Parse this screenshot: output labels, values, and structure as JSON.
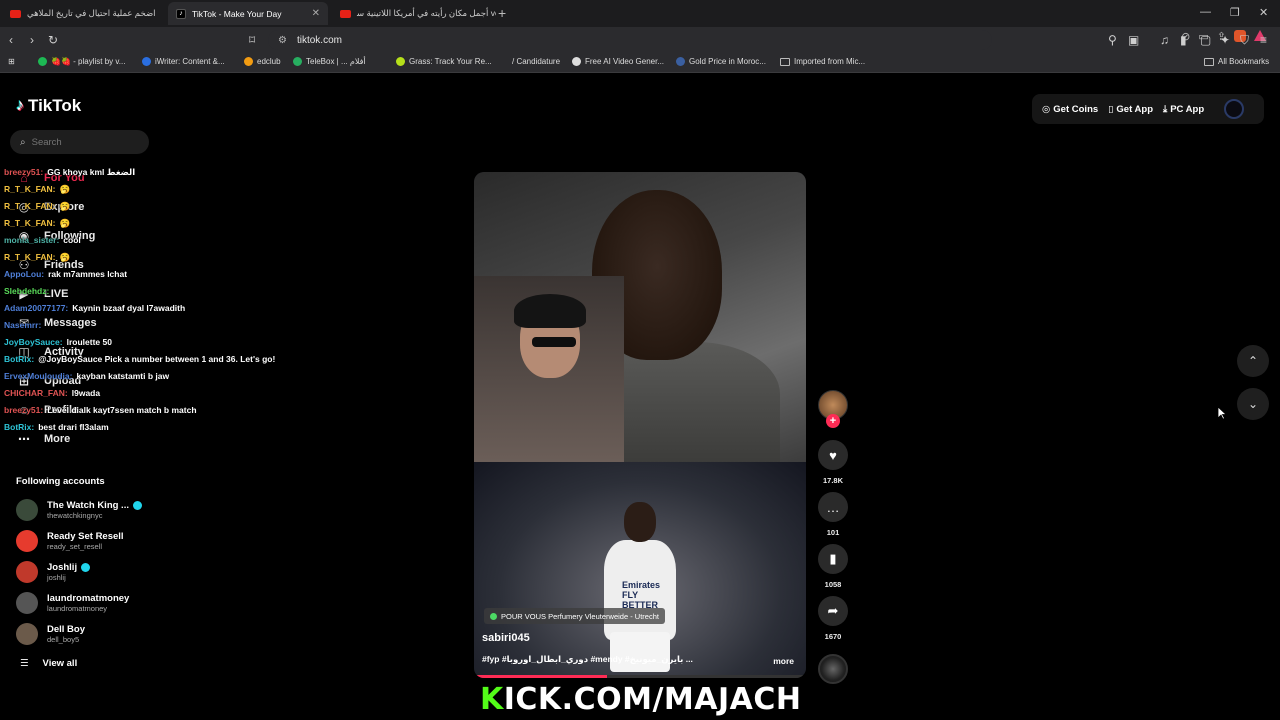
{
  "browser": {
    "tabs": [
      {
        "title": "اضخم عملية احتيال في تاريخ الملاهي",
        "active": false
      },
      {
        "title": "TikTok - Make Your Day",
        "active": true
      },
      {
        "title": "أجمل مكان رأيته في أمريكا اللاتينية ﺳ ve",
        "active": false
      }
    ],
    "url": "tiktok.com",
    "bookmarks": [
      {
        "label": "🍓🍓 - playlist by v..."
      },
      {
        "label": "iWriter: Content &..."
      },
      {
        "label": "edclub"
      },
      {
        "label": "TeleBox | ... أفلام"
      },
      {
        "label": "Grass: Track Your Re..."
      },
      {
        "label": "/ Candidature"
      },
      {
        "label": "Free AI Video Gener..."
      },
      {
        "label": "Gold Price in Moroc..."
      },
      {
        "label": "Imported from Mic..."
      }
    ],
    "all_bookmarks": "All Bookmarks"
  },
  "tiktok": {
    "logo": "TikTok",
    "search_placeholder": "Search",
    "nav": [
      {
        "label": "For You",
        "icon": "home-icon"
      },
      {
        "label": "Explore",
        "icon": "compass-icon"
      },
      {
        "label": "Following",
        "icon": "following-icon"
      },
      {
        "label": "Friends",
        "icon": "friends-icon"
      },
      {
        "label": "LIVE",
        "icon": "live-icon"
      },
      {
        "label": "Messages",
        "icon": "messages-icon"
      },
      {
        "label": "Activity",
        "icon": "activity-icon"
      },
      {
        "label": "Upload",
        "icon": "upload-icon"
      },
      {
        "label": "Profile",
        "icon": "profile-icon"
      },
      {
        "label": "More",
        "icon": "more-icon"
      }
    ],
    "following_title": "Following accounts",
    "accounts": [
      {
        "name": "The Watch King ...",
        "handle": "thewatchkingnyc",
        "verified": true,
        "color": "#3a4a3a"
      },
      {
        "name": "Ready Set Resell",
        "handle": "ready_set_resell",
        "verified": false,
        "color": "#e63b2e"
      },
      {
        "name": "Joshlij",
        "handle": "joshlij",
        "verified": true,
        "color": "#c0392b"
      },
      {
        "name": "laundromatmoney",
        "handle": "laundromatmoney",
        "verified": false,
        "color": "#555555"
      },
      {
        "name": "Dell Boy",
        "handle": "dell_boy5",
        "verified": false,
        "color": "#6b5a4a"
      }
    ],
    "view_all": "View all",
    "top_right": {
      "coins": "Get Coins",
      "app": "Get App",
      "pc_app": "PC App"
    },
    "video": {
      "location": "POUR VOUS Perfumery Vleuterweide - Utrecht",
      "author": "sabiri045",
      "caption": "#fyp #دوري_ابطال_اوروبا #mendy #بايرن_ميونيخ ...",
      "more": "more",
      "jersey_sponsor": "Emirates FLY BETTER",
      "progress": 0.4
    },
    "actions": {
      "likes": "17.8K",
      "comments": "101",
      "saves": "1058",
      "shares": "1670"
    }
  },
  "chat": [
    {
      "user": "breezy51:",
      "msg": "GG khoya kml الضغط",
      "ucolor": "#e05353"
    },
    {
      "user": "R_T_K_FAN:",
      "msg": "🥱",
      "ucolor": "#f0c040"
    },
    {
      "user": "R_T_K_FAN:",
      "msg": "🥱",
      "ucolor": "#f0c040"
    },
    {
      "user": "R_T_K_FAN:",
      "msg": "🥱",
      "ucolor": "#f0c040"
    },
    {
      "user": "monia_sister:",
      "msg": "cool",
      "ucolor": "#4fb3a7"
    },
    {
      "user": "R_T_K_FAN:",
      "msg": "🥱",
      "ucolor": "#f0c040"
    },
    {
      "user": "AppoLou:",
      "msg": "rak m7ammes lchat",
      "ucolor": "#4f7fd8"
    },
    {
      "user": "Slebdehdz:",
      "msg": "",
      "ucolor": "#5adb5a"
    },
    {
      "user": "Adam20077177:",
      "msg": "Kaynin bzaaf dyal l7awadith",
      "ucolor": "#4f7fd8"
    },
    {
      "user": "Nasemrr:",
      "msg": "",
      "ucolor": "#4f7fd8"
    },
    {
      "user": "JoyBoySauce:",
      "msg": "lroulette 50",
      "ucolor": "#2ec4d6"
    },
    {
      "user": "BotRix:",
      "msg": "@JoyBoySauce Pick a number between 1 and 36. Let's go!",
      "ucolor": "#2ec4d6"
    },
    {
      "user": "ErvexMouloudia:",
      "msg": "kayban katstamti b jaw",
      "ucolor": "#4f7fd8"
    },
    {
      "user": "CHICHAR_FAN:",
      "msg": "l9wada",
      "ucolor": "#e05353"
    },
    {
      "user": "breezy51:",
      "msg": "Level dialk kayt7ssen match b match",
      "ucolor": "#e05353"
    },
    {
      "user": "BotRix:",
      "msg": "best drari fl3alam",
      "ucolor": "#2ec4d6"
    }
  ],
  "overlay": {
    "kick_k": "K",
    "kick_rest": "ICK.COM/MAJACH"
  }
}
